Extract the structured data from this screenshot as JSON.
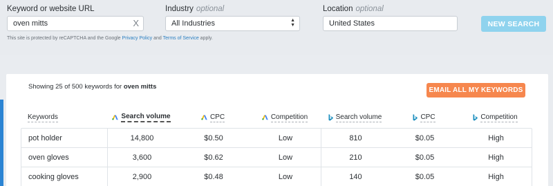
{
  "search": {
    "keyword_label": "Keyword or website URL",
    "keyword_value": "oven mitts",
    "clear_glyph": "X",
    "industry_label": "Industry",
    "industry_optional": "optional",
    "industry_value": "All Industries",
    "location_label": "Location",
    "location_optional": "optional",
    "location_value": "United States",
    "new_search_label": "NEW SEARCH",
    "recaptcha_prefix": "This site is protected by reCAPTCHA and the Google",
    "privacy_link": "Privacy Policy",
    "and_text": "and",
    "terms_link": "Terms of Service",
    "recaptcha_suffix": "apply."
  },
  "results": {
    "showing_prefix": "Showing 25 of 500 keywords for",
    "query": "oven mitts",
    "email_button": "EMAIL ALL MY KEYWORDS",
    "columns": [
      {
        "label": "Keywords",
        "icon": ""
      },
      {
        "label": "Search volume",
        "icon": "google-ads-icon"
      },
      {
        "label": "CPC",
        "icon": "google-ads-icon"
      },
      {
        "label": "Competition",
        "icon": "google-ads-icon"
      },
      {
        "label": "Search volume",
        "icon": "bing-icon"
      },
      {
        "label": "CPC",
        "icon": "bing-icon"
      },
      {
        "label": "Competition",
        "icon": "bing-icon"
      }
    ],
    "rows": [
      [
        "pot holder",
        "14,800",
        "$0.50",
        "Low",
        "810",
        "$0.05",
        "High"
      ],
      [
        "oven gloves",
        "3,600",
        "$0.62",
        "Low",
        "210",
        "$0.05",
        "High"
      ],
      [
        "cooking gloves",
        "2,900",
        "$0.48",
        "Low",
        "140",
        "$0.05",
        "High"
      ]
    ]
  },
  "colors": {
    "accent_blue": "#8fd3ee",
    "email_orange": "#f6874e",
    "link_blue": "#2a7fc1",
    "google_yellow": "#fbbc04",
    "google_blue": "#4285f4",
    "google_green": "#34a853",
    "bing_teal": "#1c8fbf"
  }
}
